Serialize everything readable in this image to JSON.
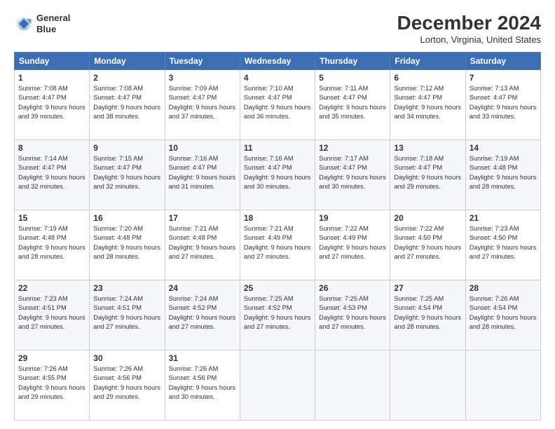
{
  "logo": {
    "line1": "General",
    "line2": "Blue"
  },
  "title": "December 2024",
  "location": "Lorton, Virginia, United States",
  "days_header": [
    "Sunday",
    "Monday",
    "Tuesday",
    "Wednesday",
    "Thursday",
    "Friday",
    "Saturday"
  ],
  "weeks": [
    [
      {
        "num": "1",
        "rise": "7:08 AM",
        "set": "4:47 PM",
        "hours": "9 hours and 39 minutes."
      },
      {
        "num": "2",
        "rise": "7:08 AM",
        "set": "4:47 PM",
        "hours": "9 hours and 38 minutes."
      },
      {
        "num": "3",
        "rise": "7:09 AM",
        "set": "4:47 PM",
        "hours": "9 hours and 37 minutes."
      },
      {
        "num": "4",
        "rise": "7:10 AM",
        "set": "4:47 PM",
        "hours": "9 hours and 36 minutes."
      },
      {
        "num": "5",
        "rise": "7:11 AM",
        "set": "4:47 PM",
        "hours": "9 hours and 35 minutes."
      },
      {
        "num": "6",
        "rise": "7:12 AM",
        "set": "4:47 PM",
        "hours": "9 hours and 34 minutes."
      },
      {
        "num": "7",
        "rise": "7:13 AM",
        "set": "4:47 PM",
        "hours": "9 hours and 33 minutes."
      }
    ],
    [
      {
        "num": "8",
        "rise": "7:14 AM",
        "set": "4:47 PM",
        "hours": "9 hours and 32 minutes."
      },
      {
        "num": "9",
        "rise": "7:15 AM",
        "set": "4:47 PM",
        "hours": "9 hours and 32 minutes."
      },
      {
        "num": "10",
        "rise": "7:16 AM",
        "set": "4:47 PM",
        "hours": "9 hours and 31 minutes."
      },
      {
        "num": "11",
        "rise": "7:16 AM",
        "set": "4:47 PM",
        "hours": "9 hours and 30 minutes."
      },
      {
        "num": "12",
        "rise": "7:17 AM",
        "set": "4:47 PM",
        "hours": "9 hours and 30 minutes."
      },
      {
        "num": "13",
        "rise": "7:18 AM",
        "set": "4:47 PM",
        "hours": "9 hours and 29 minutes."
      },
      {
        "num": "14",
        "rise": "7:19 AM",
        "set": "4:48 PM",
        "hours": "9 hours and 28 minutes."
      }
    ],
    [
      {
        "num": "15",
        "rise": "7:19 AM",
        "set": "4:48 PM",
        "hours": "9 hours and 28 minutes."
      },
      {
        "num": "16",
        "rise": "7:20 AM",
        "set": "4:48 PM",
        "hours": "9 hours and 28 minutes."
      },
      {
        "num": "17",
        "rise": "7:21 AM",
        "set": "4:48 PM",
        "hours": "9 hours and 27 minutes."
      },
      {
        "num": "18",
        "rise": "7:21 AM",
        "set": "4:49 PM",
        "hours": "9 hours and 27 minutes."
      },
      {
        "num": "19",
        "rise": "7:22 AM",
        "set": "4:49 PM",
        "hours": "9 hours and 27 minutes."
      },
      {
        "num": "20",
        "rise": "7:22 AM",
        "set": "4:50 PM",
        "hours": "9 hours and 27 minutes."
      },
      {
        "num": "21",
        "rise": "7:23 AM",
        "set": "4:50 PM",
        "hours": "9 hours and 27 minutes."
      }
    ],
    [
      {
        "num": "22",
        "rise": "7:23 AM",
        "set": "4:51 PM",
        "hours": "9 hours and 27 minutes."
      },
      {
        "num": "23",
        "rise": "7:24 AM",
        "set": "4:51 PM",
        "hours": "9 hours and 27 minutes."
      },
      {
        "num": "24",
        "rise": "7:24 AM",
        "set": "4:52 PM",
        "hours": "9 hours and 27 minutes."
      },
      {
        "num": "25",
        "rise": "7:25 AM",
        "set": "4:52 PM",
        "hours": "9 hours and 27 minutes."
      },
      {
        "num": "26",
        "rise": "7:25 AM",
        "set": "4:53 PM",
        "hours": "9 hours and 27 minutes."
      },
      {
        "num": "27",
        "rise": "7:25 AM",
        "set": "4:54 PM",
        "hours": "9 hours and 28 minutes."
      },
      {
        "num": "28",
        "rise": "7:26 AM",
        "set": "4:54 PM",
        "hours": "9 hours and 28 minutes."
      }
    ],
    [
      {
        "num": "29",
        "rise": "7:26 AM",
        "set": "4:55 PM",
        "hours": "9 hours and 29 minutes."
      },
      {
        "num": "30",
        "rise": "7:26 AM",
        "set": "4:56 PM",
        "hours": "9 hours and 29 minutes."
      },
      {
        "num": "31",
        "rise": "7:26 AM",
        "set": "4:56 PM",
        "hours": "9 hours and 30 minutes."
      },
      null,
      null,
      null,
      null
    ]
  ],
  "labels": {
    "sunrise": "Sunrise:",
    "sunset": "Sunset:",
    "daylight": "Daylight:"
  }
}
